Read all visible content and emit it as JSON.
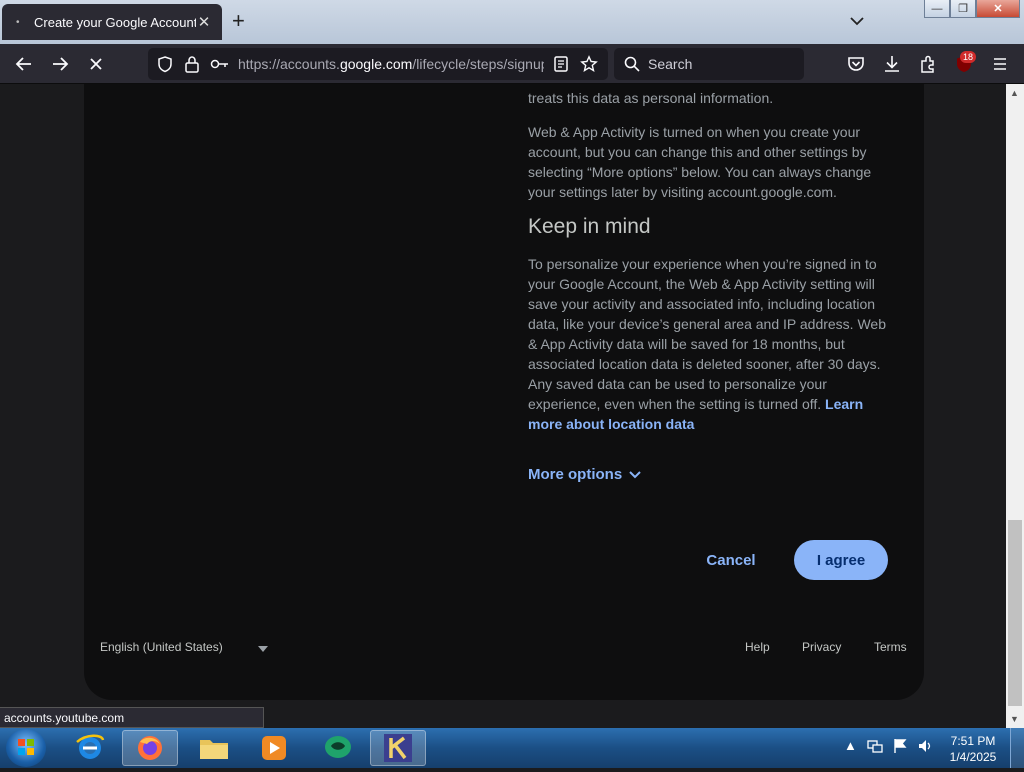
{
  "browser": {
    "tab_title": "Create your Google Account",
    "url_prefix": "https://accounts.",
    "url_domain": "google.com",
    "url_path": "/lifecycle/steps/signup",
    "search_placeholder": "Search",
    "extension_badge": "18",
    "status_url": "accounts.youtube.com"
  },
  "content": {
    "intro_tail": "treats this data as personal information.",
    "web_app_paragraph": "Web & App Activity is turned on when you create your account, but you can change this and other settings by selecting “More options” below. You can always change your settings later by visiting account.google.com.",
    "keep_in_mind_heading": "Keep in mind",
    "keep_in_mind_paragraph": "To personalize your experience when you’re signed in to your Google Account, the Web & App Activity setting will save your activity and associated info, including location data, like your device’s general area and IP address. Web & App Activity data will be saved for 18 months, but associated location data is deleted sooner, after 30 days. Any saved data can be used to personalize your experience, even when the setting is turned off.",
    "learn_more_link": "Learn more about location data",
    "more_options": "More options",
    "cancel": "Cancel",
    "agree": "I agree"
  },
  "footer": {
    "language": "English (United States)",
    "help": "Help",
    "privacy": "Privacy",
    "terms": "Terms"
  },
  "taskbar": {
    "time": "7:51 PM",
    "date": "1/4/2025",
    "apps": [
      "internet-explorer",
      "firefox",
      "file-explorer",
      "media-player",
      "app-green",
      "app-k"
    ]
  },
  "colors": {
    "accent_blue": "#8ab4f8",
    "page_bg": "#1b1b1d",
    "card_bg": "#0e0e0f"
  }
}
